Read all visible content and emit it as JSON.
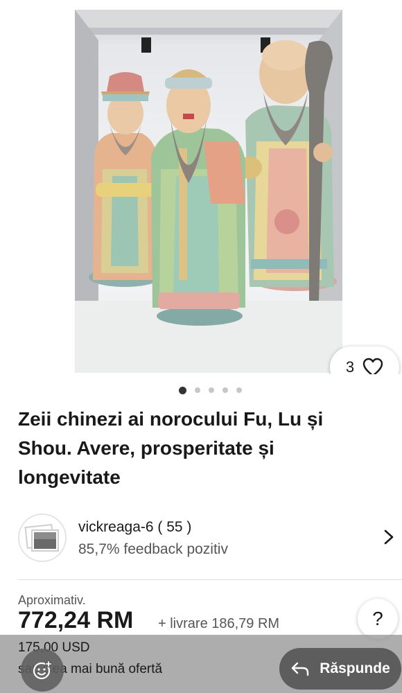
{
  "gallery": {
    "image_alt_icon": "product-photo",
    "like_count": "3",
    "dots_total": 5,
    "dots_active_index": 0
  },
  "listing": {
    "title": "Zeii chinezi ai norocului Fu, Lu și Shou. Avere, prosperitate și longevitate"
  },
  "seller": {
    "name": "vickreaga-6 ( 55 )",
    "feedback": "85,7% feedback pozitiv"
  },
  "price": {
    "approx_label": "Aproximativ.",
    "amount": "772,24 RM",
    "shipping": "+ livrare 186,79 RM",
    "original": "175,00 USD",
    "offer_note": "sau Cea mai bună ofertă"
  },
  "actions": {
    "help_label": "?",
    "reply_label": "Răspunde"
  },
  "colors": {
    "text": "#191919",
    "muted": "#555555",
    "overlay": "#969696",
    "reply_button": "#5d5d5d"
  }
}
